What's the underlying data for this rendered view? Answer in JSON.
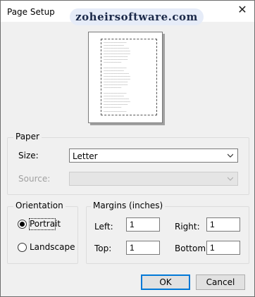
{
  "window": {
    "title": "Page Setup",
    "close_glyph": "✕",
    "watermark": "zoheirsoftware.com"
  },
  "paper": {
    "group_label": "Paper",
    "size_label": "Size:",
    "size_value": "Letter",
    "source_label": "Source:",
    "source_value": ""
  },
  "orientation": {
    "group_label": "Orientation",
    "portrait_label": "Portrait",
    "landscape_label": "Landscape",
    "selected": "portrait"
  },
  "margins": {
    "group_label": "Margins (inches)",
    "left_label": "Left:",
    "left_value": "1",
    "right_label": "Right:",
    "right_value": "1",
    "top_label": "Top:",
    "top_value": "1",
    "bottom_label": "Bottom:",
    "bottom_value": "1"
  },
  "buttons": {
    "ok_label": "OK",
    "cancel_label": "Cancel"
  },
  "colors": {
    "dialog_bg": "#f0f0f0",
    "accent": "#0078d7",
    "watermark_bg": "#e6ecf8"
  }
}
